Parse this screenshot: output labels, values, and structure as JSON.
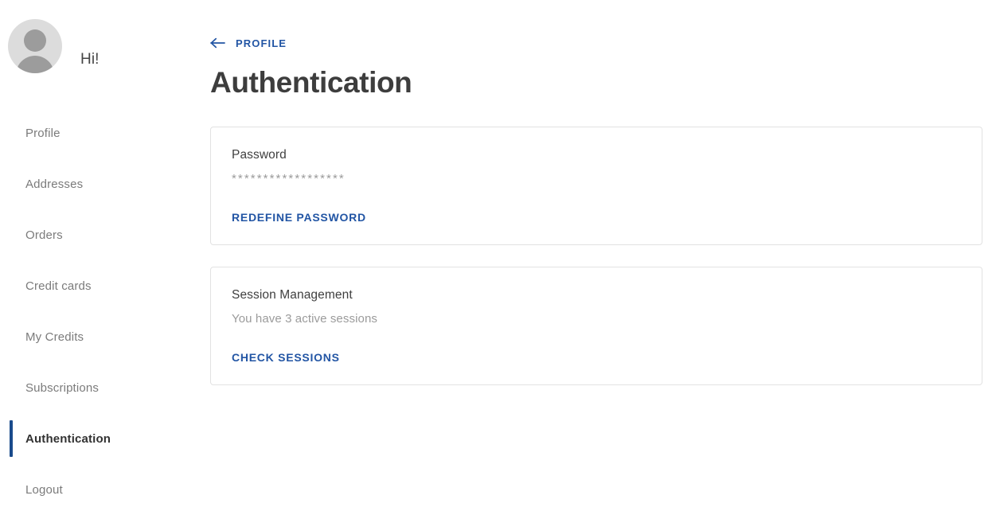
{
  "sidebar": {
    "user": {
      "greeting": "Hi!",
      "avatar_icon": "user-avatar-icon"
    },
    "items": [
      {
        "label": "Profile",
        "active": false
      },
      {
        "label": "Addresses",
        "active": false
      },
      {
        "label": "Orders",
        "active": false
      },
      {
        "label": "Credit cards",
        "active": false
      },
      {
        "label": "My Credits",
        "active": false
      },
      {
        "label": "Subscriptions",
        "active": false
      },
      {
        "label": "Authentication",
        "active": true
      },
      {
        "label": "Logout",
        "active": false
      }
    ]
  },
  "header": {
    "breadcrumb_label": "PROFILE",
    "back_icon": "arrow-left-icon",
    "title": "Authentication"
  },
  "cards": [
    {
      "id": "password",
      "title": "Password",
      "value": "******************",
      "action_label": "REDEFINE PASSWORD"
    },
    {
      "id": "session-management",
      "title": "Session Management",
      "subtitle": "You have 3 active sessions",
      "action_label": "CHECK SESSIONS"
    }
  ],
  "colors": {
    "link_blue": "#2255a4",
    "accent_bar": "#1a4b8c",
    "heading": "#3d3d3d",
    "muted_text": "#9b9b9b",
    "nav_text": "#7b7b7b",
    "card_border": "#e2e2e2"
  }
}
